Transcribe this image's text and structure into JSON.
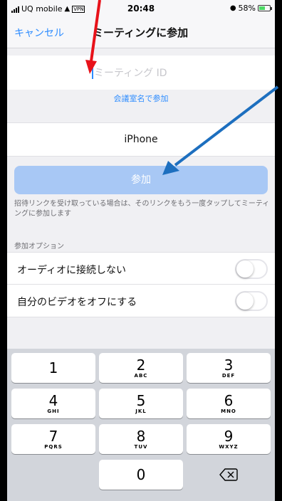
{
  "status_bar": {
    "carrier": "UQ mobile",
    "time": "20:48",
    "battery": "58%",
    "battery_level": 0.58
  },
  "nav": {
    "cancel_label": "キャンセル",
    "title": "ミーティングに参加"
  },
  "meeting_id": {
    "value": "",
    "placeholder": "ミーティング ID"
  },
  "room_link_label": "会議室名で参加",
  "display_name": "iPhone",
  "join_button_label": "参加",
  "hint_text": "招待リンクを受け取っている場合は、そのリンクをもう一度タップしてミーティングに参加します",
  "options": {
    "header": "参加オプション",
    "items": [
      {
        "label": "オーディオに接続しない",
        "on": false
      },
      {
        "label": "自分のビデオをオフにする",
        "on": false
      }
    ]
  },
  "keypad": {
    "keys": [
      {
        "digit": "1",
        "letters": ""
      },
      {
        "digit": "2",
        "letters": "ABC"
      },
      {
        "digit": "3",
        "letters": "DEF"
      },
      {
        "digit": "4",
        "letters": "GHI"
      },
      {
        "digit": "5",
        "letters": "JKL"
      },
      {
        "digit": "6",
        "letters": "MNO"
      },
      {
        "digit": "7",
        "letters": "PQRS"
      },
      {
        "digit": "8",
        "letters": "TUV"
      },
      {
        "digit": "9",
        "letters": "WXYZ"
      },
      {
        "digit": "0",
        "letters": ""
      }
    ],
    "delete_icon": "backspace-icon"
  },
  "colors": {
    "accent": "#2d8cff",
    "join_button": "#a8c8f5",
    "red_arrow": "#e8121a",
    "blue_arrow": "#1d6fbf"
  }
}
